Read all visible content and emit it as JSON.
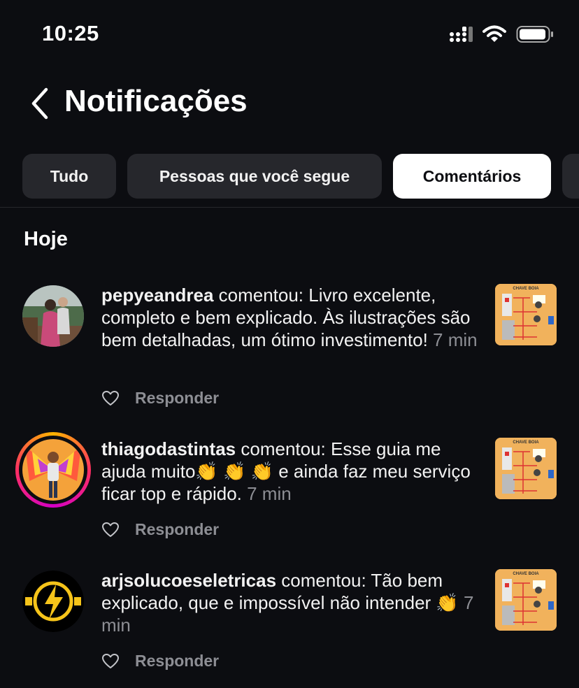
{
  "status_bar": {
    "time": "10:25"
  },
  "header": {
    "title": "Notificações"
  },
  "tabs": [
    {
      "label": "Tudo"
    },
    {
      "label": "Pessoas que você segue"
    },
    {
      "label": "Comentários"
    },
    {
      "label": ""
    }
  ],
  "section": {
    "title": "Hoje"
  },
  "thumb_text": "CHAVE BOIA",
  "notifications": [
    {
      "username": "pepyeandrea",
      "message": " comentou: Livro excelente, completo e bem explicado. Às ilustrações são bem detalhadas, um ótimo investimento! ",
      "time": "7 min",
      "reply_label": "Responder"
    },
    {
      "username": "thiagodastintas",
      "message": " comentou: Esse guia me ajuda muito👏 👏 👏  e ainda faz meu serviço ficar top e rápido. ",
      "time": "7 min",
      "reply_label": "Responder"
    },
    {
      "username": "arjsolucoeseletricas",
      "message": " comentou: Tão bem explicado, que e impossível não intender 👏 ",
      "time": "7 min",
      "reply_label": "Responder"
    }
  ],
  "colors": {
    "background": "#0c0d11",
    "tab_bg": "#26272c",
    "muted": "#8d8e94",
    "active_tab": "#ffffff"
  }
}
